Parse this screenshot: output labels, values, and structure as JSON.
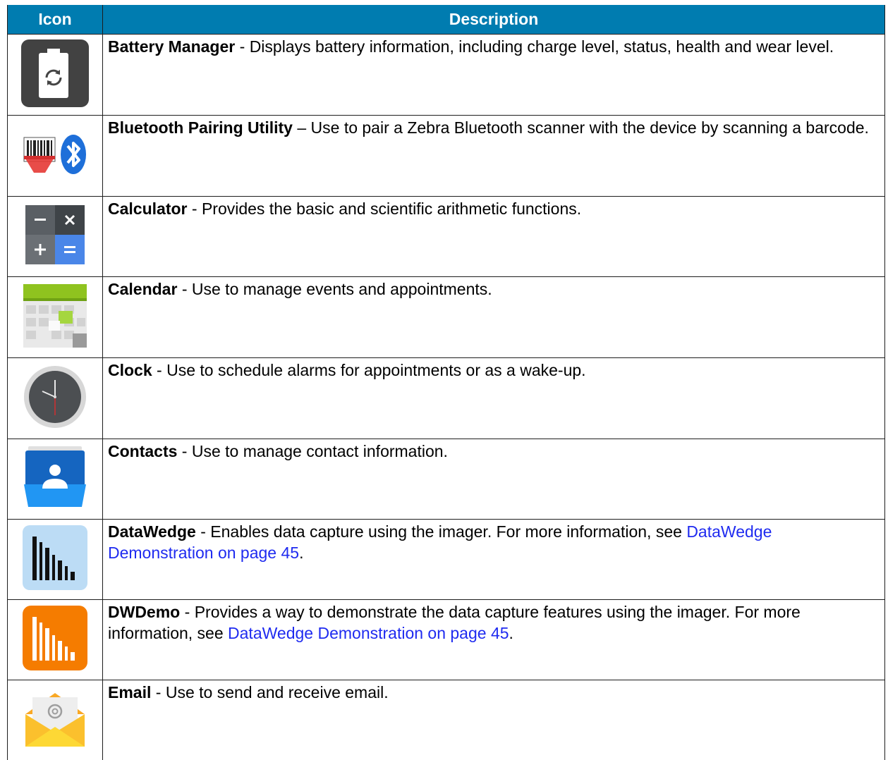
{
  "table": {
    "headers": {
      "icon": "Icon",
      "description": "Description"
    },
    "rows": [
      {
        "icon": "battery-manager-icon",
        "name": "Battery Manager",
        "sep": " - ",
        "text": "Displays battery information, including charge level, status, health and wear level.",
        "link": "",
        "tail": ""
      },
      {
        "icon": "bluetooth-pairing-icon",
        "name": "Bluetooth Pairing Utility",
        "sep": " – ",
        "text": "Use to pair a Zebra Bluetooth scanner with the device by scanning a barcode.",
        "link": "",
        "tail": ""
      },
      {
        "icon": "calculator-icon",
        "name": "Calculator",
        "sep": " - ",
        "text": "Provides the basic and scientific arithmetic functions.",
        "link": "",
        "tail": ""
      },
      {
        "icon": "calendar-icon",
        "name": "Calendar",
        "sep": " - ",
        "text": "Use to manage events and appointments.",
        "link": "",
        "tail": ""
      },
      {
        "icon": "clock-icon",
        "name": "Clock",
        "sep": " - ",
        "text": "Use to schedule alarms for appointments or as a wake-up.",
        "link": "",
        "tail": ""
      },
      {
        "icon": "contacts-icon",
        "name": "Contacts",
        "sep": " - ",
        "text": "Use to manage contact information.",
        "link": "",
        "tail": ""
      },
      {
        "icon": "datawedge-icon",
        "name": "DataWedge",
        "sep": " - ",
        "text": "Enables data capture using the imager. For more information, see ",
        "link": "DataWedge Demonstration on page 45",
        "tail": "."
      },
      {
        "icon": "dwdemo-icon",
        "name": "DWDemo",
        "sep": " - ",
        "text": "Provides a way to demonstrate the data capture features using the imager. For more information, see ",
        "link": "DataWedge Demonstration on page 45",
        "tail": "."
      },
      {
        "icon": "email-icon",
        "name": "Email",
        "sep": " - ",
        "text": "Use to send and receive email.",
        "link": "",
        "tail": ""
      }
    ]
  },
  "colors": {
    "header_bg": "#007cb0",
    "link": "#1f2bf0"
  }
}
